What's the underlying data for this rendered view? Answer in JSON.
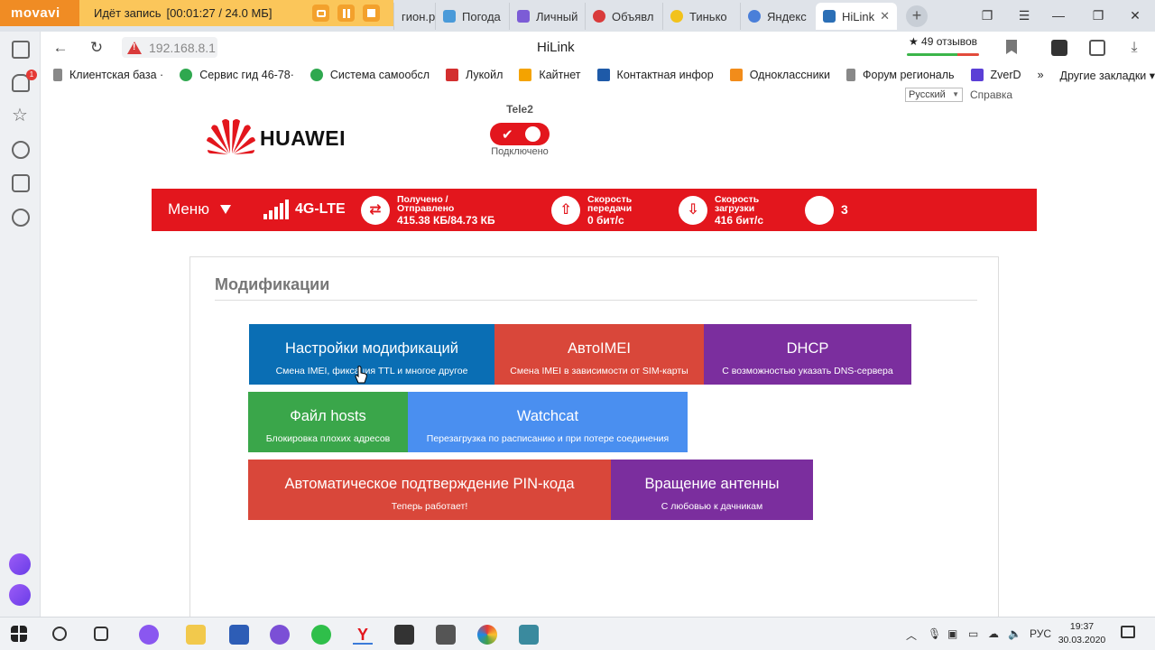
{
  "recorder": {
    "brand": "movavi",
    "status_text": "Идёт запись",
    "time_text": "[00:01:27 / 24.0 МБ]"
  },
  "tabs": [
    {
      "label": "гион.р",
      "icon_color": "#7aa6d8",
      "active": false
    },
    {
      "label": "Погода",
      "icon_color": "#4a9ad9",
      "active": false
    },
    {
      "label": "Личный",
      "icon_color": "#7c5cd6",
      "active": false
    },
    {
      "label": "Объявл",
      "icon_color": "#d93b3b",
      "active": false
    },
    {
      "label": "Тинько",
      "icon_color": "#f2c21b",
      "active": false
    },
    {
      "label": "Яндекс",
      "icon_color": "#4a7fd9",
      "active": false
    },
    {
      "label": "HiLink",
      "icon_color": "#2b6fb6",
      "active": true
    }
  ],
  "address_bar": {
    "url": "192.168.8.1",
    "page_title": "HiLink",
    "reviews": "★ 49 отзывов"
  },
  "bookmarks": [
    {
      "label": "Клиентская база ·",
      "icon_color": "#888888"
    },
    {
      "label": "Сервис гид 46-78·",
      "icon_color": "#2fa84f"
    },
    {
      "label": "Система самообсл",
      "icon_color": "#2fa84f"
    },
    {
      "label": "Лукойл",
      "icon_color": "#d32f2f"
    },
    {
      "label": "Кайтнет",
      "icon_color": "#f4a300"
    },
    {
      "label": "Контактная инфор",
      "icon_color": "#1e5aa8"
    },
    {
      "label": "Одноклассники",
      "icon_color": "#f28c1a"
    },
    {
      "label": "Форум региональ",
      "icon_color": "#888888"
    },
    {
      "label": "ZverD",
      "icon_color": "#5b3fd6"
    }
  ],
  "bookmarks_more": "»",
  "bookmarks_other": "Другие закладки ▾",
  "header": {
    "language": "Русский",
    "help": "Справка",
    "logo_text": "HUAWEI",
    "carrier": "Tele2",
    "connection_status": "Подключено"
  },
  "statusbar": {
    "menu_label": "Меню",
    "network_type": "4G-LTE",
    "signal_bars": 5,
    "traffic_label": "Получено / Отправлено",
    "traffic_value": "415.38 КБ/84.73 КБ",
    "upload_label": "Скорость передачи",
    "upload_value": "0 бит/с",
    "download_label": "Скорость загрузки",
    "download_value": "416 бит/с",
    "count": "3"
  },
  "panel": {
    "title": "Модификации"
  },
  "tiles": [
    {
      "title": "Настройки модификаций",
      "subtitle": "Смена IMEI, фиксация TTL и многое другое",
      "color": "#0a6eb4"
    },
    {
      "title": "АвтоIMEI",
      "subtitle": "Смена IMEI в зависимости от SIM-карты",
      "color": "#d9473a"
    },
    {
      "title": "DHCP",
      "subtitle": "С возможностью указать DNS-сервера",
      "color": "#7b2e9e"
    },
    {
      "title": "Файл hosts",
      "subtitle": "Блокировка плохих адресов",
      "color": "#3aa64a"
    },
    {
      "title": "Watchcat",
      "subtitle": "Перезагрузка по расписанию и при потере соединения",
      "color": "#4a8ff0"
    },
    {
      "title": "Автоматическое подтверждение PIN-кода",
      "subtitle": "Теперь работает!",
      "color": "#d9473a"
    },
    {
      "title": "Вращение антенны",
      "subtitle": "С любовью к дачникам",
      "color": "#7b2e9e"
    }
  ],
  "taskbar": {
    "language": "РУС",
    "time": "19:37",
    "date": "30.03.2020"
  }
}
